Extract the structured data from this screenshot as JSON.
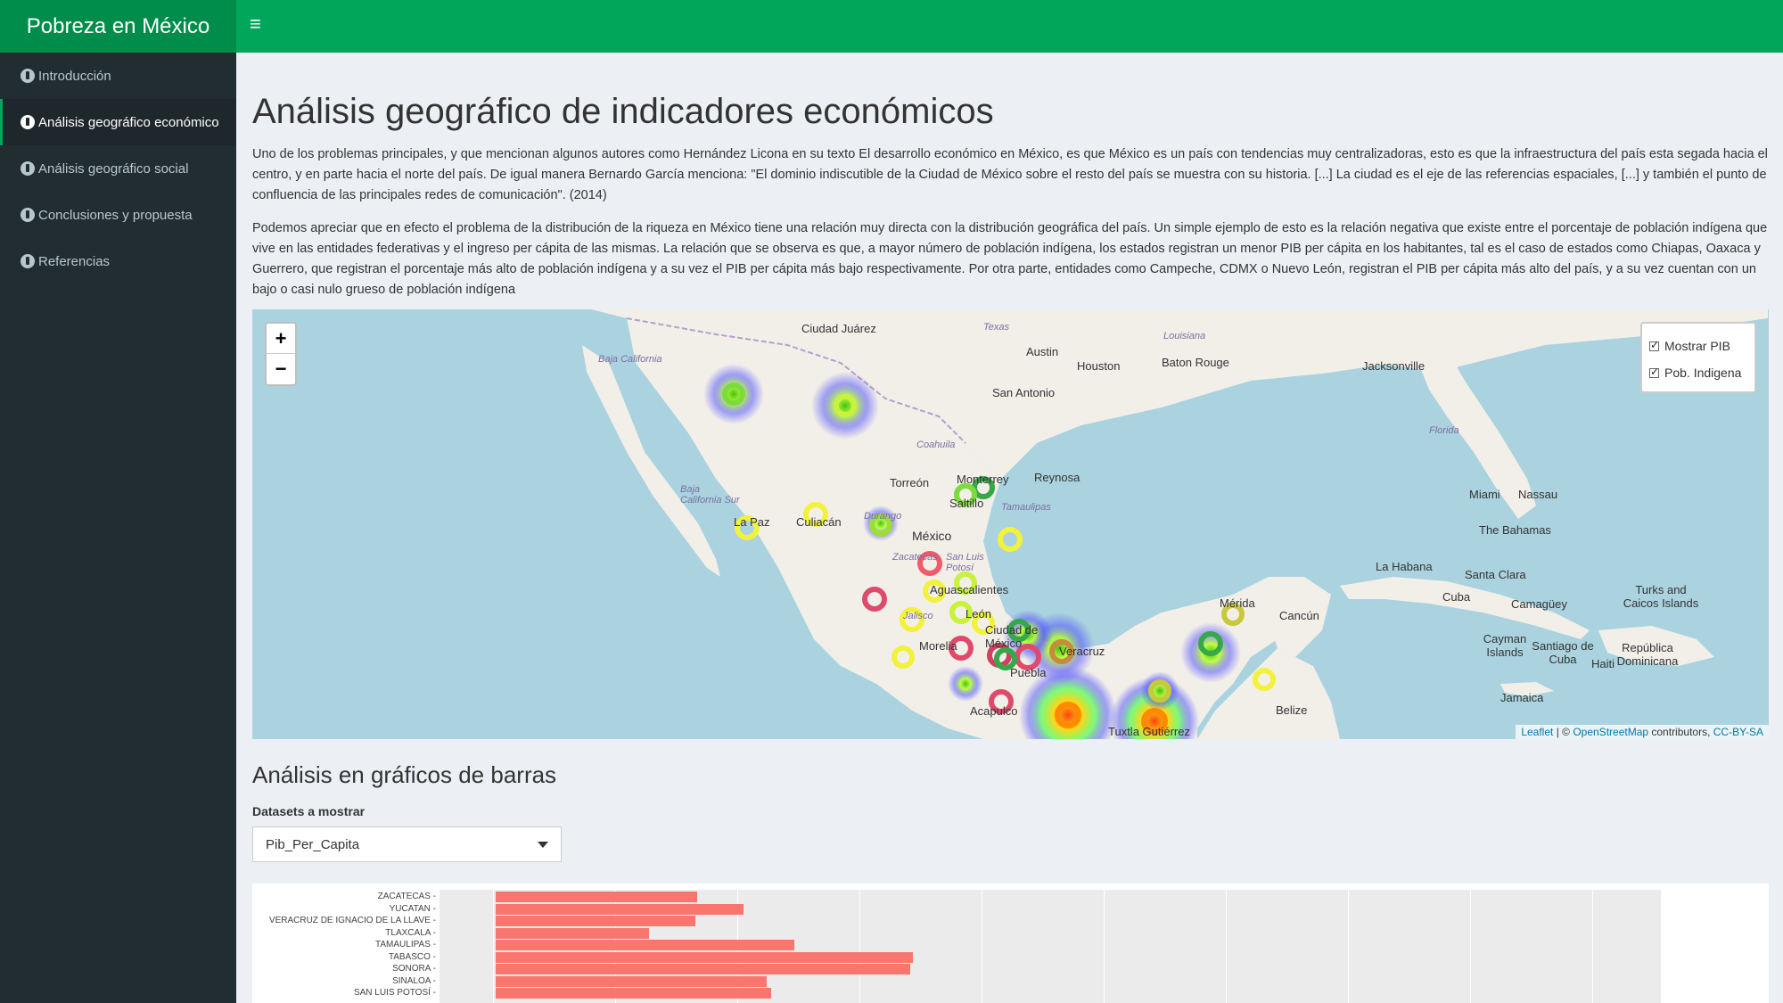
{
  "header": {
    "title": "Pobreza en México",
    "menu_icon": "≡"
  },
  "sidebar": {
    "items": [
      {
        "label": "Introducción",
        "active": false
      },
      {
        "label": "Análisis geográfico económico",
        "active": true
      },
      {
        "label": "Análisis geográfico social",
        "active": false
      },
      {
        "label": "Conclusiones y propuesta",
        "active": false
      },
      {
        "label": "Referencias",
        "active": false
      }
    ]
  },
  "main": {
    "title": "Análisis geográfico de indicadores económicos",
    "paragraph1": "Uno de los problemas principales, y que mencionan algunos autores como Hernández Licona en su texto El desarrollo económico en México, es que México es un país con tendencias muy centralizadoras, esto es que la infraestructura del país esta segada hacia el centro, y en parte hacia el norte del país. De igual manera Bernardo García menciona: \"El dominio indiscutible de la Ciudad de México sobre el resto del país se muestra con su historia. [...] La ciudad es el eje de las referencias espaciales, [...] y también el punto de confluencia de las principales redes de comunicación\". (2014)",
    "paragraph2": "Podemos apreciar que en efecto el problema de la distribución de la riqueza en México tiene una relación muy directa con la distribución geográfica del país. Un simple ejemplo de esto es la relación negativa que existe entre el porcentaje de población indígena que vive en las entidades federativas y el ingreso per cápita de las mismas. La relación que se observa es que, a mayor número de población indígena, los estados registran un menor PIB per cápita en los habitantes, tal es el caso de estados como Chiapas, Oaxaca y Guerrero, que registran el porcentaje más alto de población indígena y a su vez el PIB per cápita más bajo respectivamente. Por otra parte, entidades como Campeche, CDMX o Nuevo León, registran el PIB per cápita más alto del país, y a su vez cuentan con un bajo o casi nulo grueso de población indígena"
  },
  "map": {
    "zoom_in": "+",
    "zoom_out": "−",
    "layers": [
      {
        "label": "Mostrar PIB",
        "checked": true
      },
      {
        "label": "Pob. Indigena",
        "checked": true
      }
    ],
    "attribution": {
      "leaflet": "Leaflet",
      "sep": " | © ",
      "osm": "OpenStreetMap",
      "contrib": " contributors, ",
      "license": "CC-BY-SA"
    },
    "labels": {
      "l1": "Ciudad Juárez",
      "l2": "Texas",
      "l3": "Louisiana",
      "l4": "Austin",
      "l5": "Houston",
      "l6": "Baton Rouge",
      "l7": "Jacksonville",
      "l8": "San Antonio",
      "l9": "Baja California",
      "l10": "Coahuila",
      "l11": "Torreón",
      "l12": "Monterrey",
      "l13": "Reynosa",
      "l14": "Saltillo",
      "l15": "Tamaulipas",
      "l16": "Florida",
      "l17": "Miami",
      "l18": "Nassau",
      "l19": "Baja California Sur",
      "l20": "Culiacán",
      "l21": "La Paz",
      "l22": "Durango",
      "l23": "México",
      "l24": "The Bahamas",
      "l25": "Zacatecas",
      "l26": "San Luis Potosí",
      "l27": "La Habana",
      "l28": "Santa Clara",
      "l29": "Aguascalientes",
      "l30": "Cuba",
      "l31": "Camagüey",
      "l32": "Turks and Caicos Islands",
      "l33": "Mérida",
      "l34": "Cancún",
      "l35": "Jalisco",
      "l36": "León",
      "l37": "Ciudad de México",
      "l38": "Morelia",
      "l39": "Veracruz",
      "l40": "Puebla",
      "l41": "Cayman Islands",
      "l42": "Santiago de Cuba",
      "l43": "República Dominicana",
      "l44": "Haiti",
      "l45": "Acapulco",
      "l46": "Belize",
      "l47": "Jamaica",
      "l48": "Tuxtla Gutiérrez"
    }
  },
  "bars_section": {
    "title": "Análisis en gráficos de barras",
    "select_label": "Datasets a mostrar",
    "select_value": "Pib_Per_Capita"
  },
  "colors": {
    "header": "#00a65a",
    "brand": "#008d4c",
    "sidebar": "#222d32",
    "bar": "#f8766d"
  },
  "chart_data": {
    "type": "bar",
    "orientation": "horizontal",
    "categories": [
      "ZACATECAS",
      "YUCATAN",
      "VERACRUZ DE IGNACIO DE LA LLAVE",
      "TLAXCALA",
      "TAMAULIPAS",
      "TABASCO",
      "SONORA",
      "SINALOA",
      "SAN LUIS POTOSÍ"
    ],
    "values": [
      87,
      107,
      86,
      66,
      129,
      180,
      179,
      117,
      119
    ],
    "xlim": [
      0,
      530
    ]
  }
}
